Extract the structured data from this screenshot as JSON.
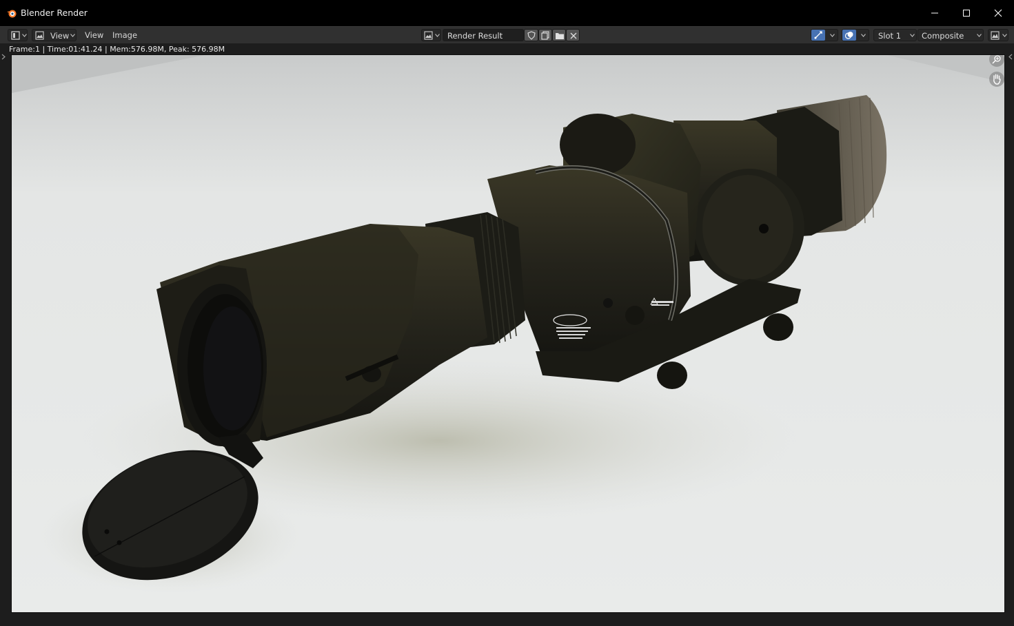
{
  "window": {
    "title": "Blender Render",
    "controls": [
      "minimize",
      "maximize",
      "close"
    ]
  },
  "header": {
    "editor_type_icon": "image-editor-icon",
    "view_menu_dropdown": "View",
    "menus": [
      "View",
      "Image"
    ],
    "image_name": "Render Result",
    "image_buttons": [
      "fake-user-shield-icon",
      "new-image-icon",
      "open-image-folder-icon",
      "unlink-x-icon"
    ],
    "slot": "Slot 1",
    "layer": "Composite",
    "display_channels_icon": "display-channels-icon"
  },
  "stats": {
    "text": "Frame:1 | Time:01:41.24 | Mem:576.98M, Peak: 576.98M"
  },
  "viewport": {
    "content": "render-image",
    "nav_icons": [
      "zoom-icon",
      "pan-hand-icon"
    ]
  },
  "colors": {
    "titlebar": "#000000",
    "header": "#303030",
    "accent_blue": "#4772b3"
  }
}
